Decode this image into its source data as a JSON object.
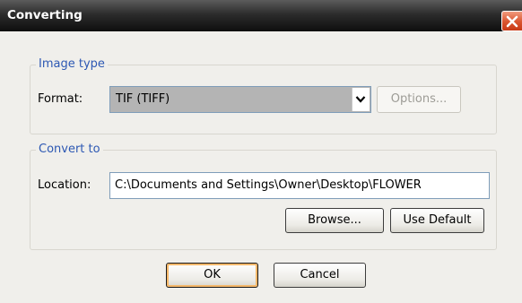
{
  "window": {
    "title": "Converting"
  },
  "image_type": {
    "legend": "Image type",
    "format_label": "Format:",
    "format_value": "TIF (TIFF)",
    "options_label": "Options..."
  },
  "convert_to": {
    "legend": "Convert to",
    "location_label": "Location:",
    "location_value": "C:\\Documents and Settings\\Owner\\Desktop\\FLOWER",
    "browse_label": "Browse...",
    "use_default_label": "Use Default"
  },
  "footer": {
    "ok_label": "OK",
    "cancel_label": "Cancel"
  },
  "colors": {
    "title_bar": "#1c1c1c",
    "close_button": "#d9542e",
    "legend_text": "#2d58b3",
    "dialog_bg": "#f0efeb"
  },
  "icons": {
    "close": "close-icon",
    "dropdown": "chevron-down-icon"
  }
}
